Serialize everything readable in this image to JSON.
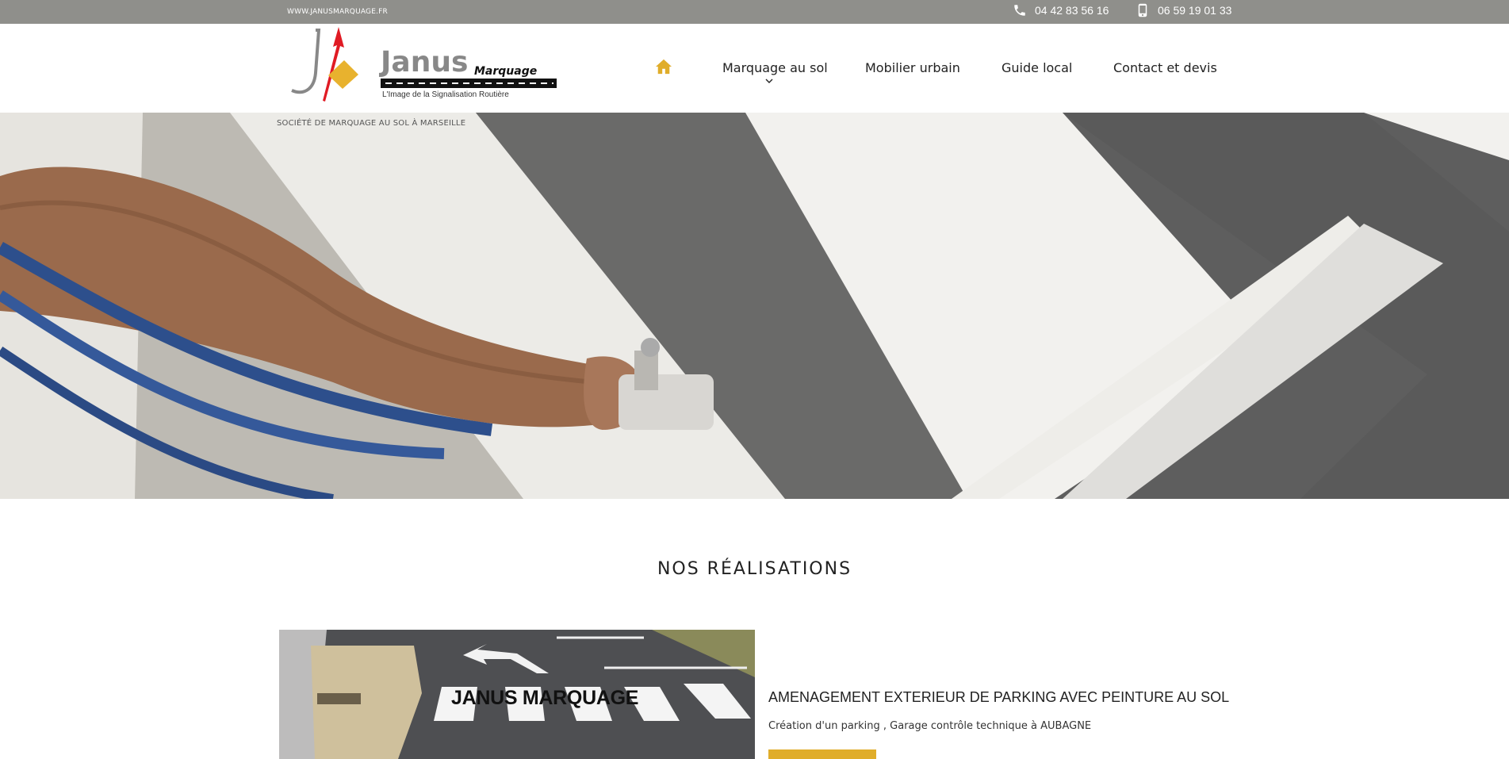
{
  "topbar": {
    "site_url": "WWW.JANUSMARQUAGE.FR",
    "phone_landline": "04 42 83 56 16",
    "phone_mobile": "06 59 19 01 33",
    "phone_icon": "phone-icon",
    "mobile_icon": "mobile-phone-icon",
    "background": "#8f8f8b"
  },
  "header": {
    "logo": {
      "brand": "Janus",
      "brand_sub": "Marquage",
      "slogan": "L'Image de la Signalisation Routière"
    },
    "nav": {
      "home_icon": "home-icon",
      "items": [
        {
          "label": "Marquage au sol",
          "has_dropdown": true
        },
        {
          "label": "Mobilier urbain"
        },
        {
          "label": "Guide local"
        },
        {
          "label": "Contact et devis"
        }
      ]
    },
    "accent": "#e0ad2a"
  },
  "hero": {
    "tagline": "SOCIÉTÉ DE MARQUAGE AU SOL À MARSEILLE"
  },
  "realisations": {
    "section_title": "NOS RÉALISATIONS",
    "items": [
      {
        "image_caption": "JANUS MARQUAGE",
        "title": "AMENAGEMENT EXTERIEUR DE PARKING AVEC PEINTURE AU SOL",
        "description": "Création d'un parking , Garage contrôle technique à AUBAGNE"
      }
    ]
  }
}
